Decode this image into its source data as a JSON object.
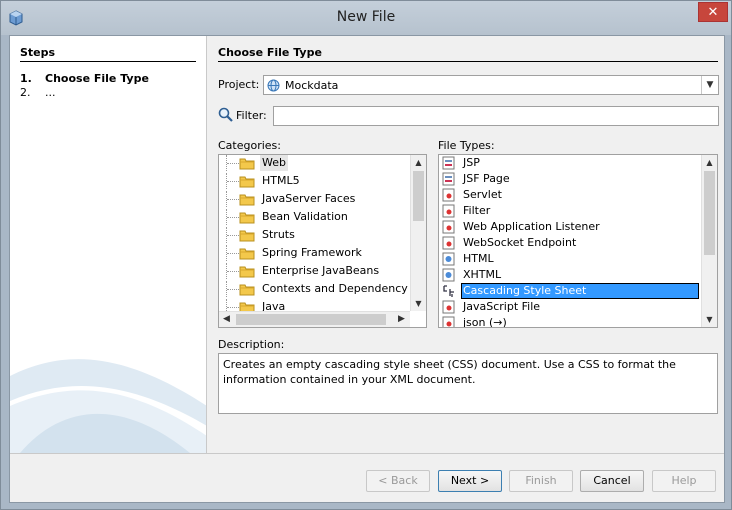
{
  "window": {
    "title": "New File",
    "close_glyph": "✕",
    "accent_color": "#3399ff"
  },
  "steps": {
    "title": "Steps",
    "items": [
      {
        "num": "1.",
        "label": "Choose File Type"
      },
      {
        "num": "2.",
        "label": "..."
      }
    ]
  },
  "main": {
    "title": "Choose File Type",
    "project_label": "Project:",
    "project_value": "Mockdata",
    "filter_label": "Filter:",
    "filter_value": "",
    "categories_label": "Categories:",
    "categories": [
      "Web",
      "HTML5",
      "JavaServer Faces",
      "Bean Validation",
      "Struts",
      "Spring Framework",
      "Enterprise JavaBeans",
      "Contexts and Dependency Inje",
      "Java"
    ],
    "selected_category": "Web",
    "file_types_label": "File Types:",
    "file_types": [
      {
        "label": "JSP",
        "icon": "jsp-icon"
      },
      {
        "label": "JSF Page",
        "icon": "jsf-page-icon"
      },
      {
        "label": "Servlet",
        "icon": "servlet-icon"
      },
      {
        "label": "Filter",
        "icon": "filter-icon"
      },
      {
        "label": "Web Application Listener",
        "icon": "listener-icon"
      },
      {
        "label": "WebSocket Endpoint",
        "icon": "websocket-icon"
      },
      {
        "label": "HTML",
        "icon": "html-icon"
      },
      {
        "label": "XHTML",
        "icon": "xhtml-icon"
      },
      {
        "label": "Cascading Style Sheet",
        "icon": "css-icon"
      },
      {
        "label": "JavaScript File",
        "icon": "javascript-icon"
      },
      {
        "label": "json (→)",
        "icon": "json-icon"
      }
    ],
    "selected_file_type": "Cascading Style Sheet",
    "description_label": "Description:",
    "description": "Creates an empty cascading style sheet (CSS) document. Use a CSS to format the information contained in your XML document."
  },
  "buttons": {
    "back": "< Back",
    "next": "Next >",
    "finish": "Finish",
    "cancel": "Cancel",
    "help": "Help"
  }
}
